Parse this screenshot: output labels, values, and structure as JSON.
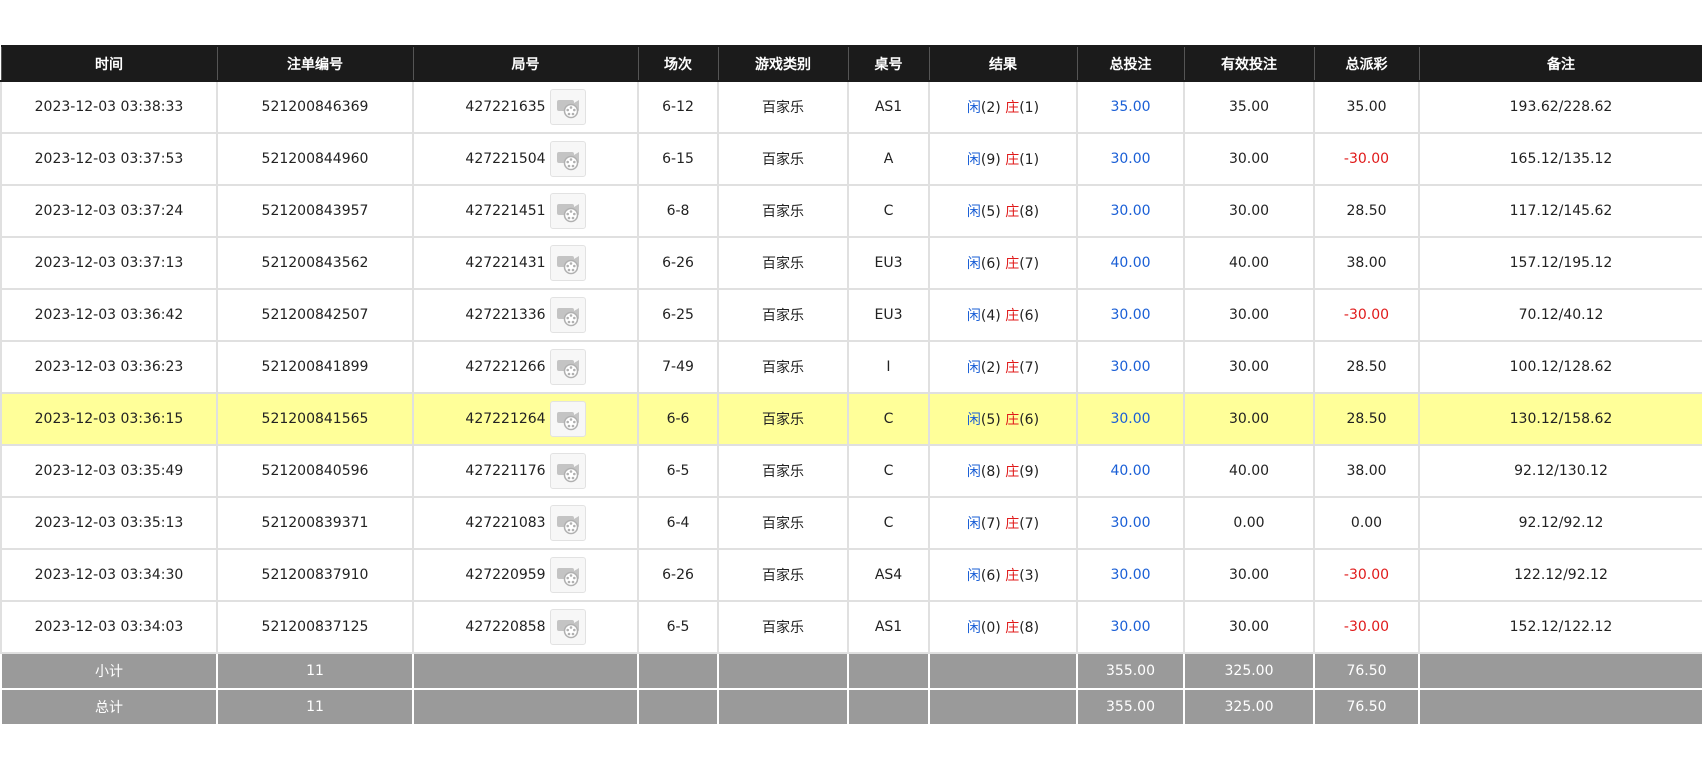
{
  "columns": [
    "时间",
    "注单编号",
    "局号",
    "场次",
    "游戏类别",
    "桌号",
    "结果",
    "总投注",
    "有效投注",
    "总派彩",
    "备注"
  ],
  "rows": [
    {
      "time": "2023-12-03 03:38:33",
      "bet_id": "521200846369",
      "round": "427221635",
      "session": "6-12",
      "game": "百家乐",
      "table": "AS1",
      "player_label": "闲",
      "player_score": "(2)",
      "banker_label": "庄",
      "banker_score": "(1)",
      "total_bet": "35.00",
      "valid_bet": "35.00",
      "payout": "35.00",
      "payout_negative": false,
      "remark": "193.62/228.62"
    },
    {
      "time": "2023-12-03 03:37:53",
      "bet_id": "521200844960",
      "round": "427221504",
      "session": "6-15",
      "game": "百家乐",
      "table": "A",
      "player_label": "闲",
      "player_score": "(9)",
      "banker_label": "庄",
      "banker_score": "(1)",
      "total_bet": "30.00",
      "valid_bet": "30.00",
      "payout": "-30.00",
      "payout_negative": true,
      "remark": "165.12/135.12"
    },
    {
      "time": "2023-12-03 03:37:24",
      "bet_id": "521200843957",
      "round": "427221451",
      "session": "6-8",
      "game": "百家乐",
      "table": "C",
      "player_label": "闲",
      "player_score": "(5)",
      "banker_label": "庄",
      "banker_score": "(8)",
      "total_bet": "30.00",
      "valid_bet": "30.00",
      "payout": "28.50",
      "payout_negative": false,
      "remark": "117.12/145.62"
    },
    {
      "time": "2023-12-03 03:37:13",
      "bet_id": "521200843562",
      "round": "427221431",
      "session": "6-26",
      "game": "百家乐",
      "table": "EU3",
      "player_label": "闲",
      "player_score": "(6)",
      "banker_label": "庄",
      "banker_score": "(7)",
      "total_bet": "40.00",
      "valid_bet": "40.00",
      "payout": "38.00",
      "payout_negative": false,
      "remark": "157.12/195.12"
    },
    {
      "time": "2023-12-03 03:36:42",
      "bet_id": "521200842507",
      "round": "427221336",
      "session": "6-25",
      "game": "百家乐",
      "table": "EU3",
      "player_label": "闲",
      "player_score": "(4)",
      "banker_label": "庄",
      "banker_score": "(6)",
      "total_bet": "30.00",
      "valid_bet": "30.00",
      "payout": "-30.00",
      "payout_negative": true,
      "remark": "70.12/40.12"
    },
    {
      "time": "2023-12-03 03:36:23",
      "bet_id": "521200841899",
      "round": "427221266",
      "session": "7-49",
      "game": "百家乐",
      "table": "I",
      "player_label": "闲",
      "player_score": "(2)",
      "banker_label": "庄",
      "banker_score": "(7)",
      "total_bet": "30.00",
      "valid_bet": "30.00",
      "payout": "28.50",
      "payout_negative": false,
      "remark": "100.12/128.62"
    },
    {
      "time": "2023-12-03 03:36:15",
      "bet_id": "521200841565",
      "round": "427221264",
      "session": "6-6",
      "game": "百家乐",
      "table": "C",
      "player_label": "闲",
      "player_score": "(5)",
      "banker_label": "庄",
      "banker_score": "(6)",
      "total_bet": "30.00",
      "valid_bet": "30.00",
      "payout": "28.50",
      "payout_negative": false,
      "remark": "130.12/158.62",
      "highlight": true
    },
    {
      "time": "2023-12-03 03:35:49",
      "bet_id": "521200840596",
      "round": "427221176",
      "session": "6-5",
      "game": "百家乐",
      "table": "C",
      "player_label": "闲",
      "player_score": "(8)",
      "banker_label": "庄",
      "banker_score": "(9)",
      "total_bet": "40.00",
      "valid_bet": "40.00",
      "payout": "38.00",
      "payout_negative": false,
      "remark": "92.12/130.12"
    },
    {
      "time": "2023-12-03 03:35:13",
      "bet_id": "521200839371",
      "round": "427221083",
      "session": "6-4",
      "game": "百家乐",
      "table": "C",
      "player_label": "闲",
      "player_score": "(7)",
      "banker_label": "庄",
      "banker_score": "(7)",
      "total_bet": "30.00",
      "valid_bet": "0.00",
      "payout": "0.00",
      "payout_negative": false,
      "remark": "92.12/92.12"
    },
    {
      "time": "2023-12-03 03:34:30",
      "bet_id": "521200837910",
      "round": "427220959",
      "session": "6-26",
      "game": "百家乐",
      "table": "AS4",
      "player_label": "闲",
      "player_score": "(6)",
      "banker_label": "庄",
      "banker_score": "(3)",
      "total_bet": "30.00",
      "valid_bet": "30.00",
      "payout": "-30.00",
      "payout_negative": true,
      "remark": "122.12/92.12"
    },
    {
      "time": "2023-12-03 03:34:03",
      "bet_id": "521200837125",
      "round": "427220858",
      "session": "6-5",
      "game": "百家乐",
      "table": "AS1",
      "player_label": "闲",
      "player_score": "(0)",
      "banker_label": "庄",
      "banker_score": "(8)",
      "total_bet": "30.00",
      "valid_bet": "30.00",
      "payout": "-30.00",
      "payout_negative": true,
      "remark": "152.12/122.12"
    }
  ],
  "subtotal": {
    "label": "小计",
    "count": "11",
    "total_bet": "355.00",
    "valid_bet": "325.00",
    "payout": "76.50"
  },
  "grandtotal": {
    "label": "总计",
    "count": "11",
    "total_bet": "355.00",
    "valid_bet": "325.00",
    "payout": "76.50"
  },
  "icons": {
    "replay": "video-replay-icon"
  },
  "colors": {
    "header_bg": "#1b1b1b",
    "footer_bg": "#9a9a9a",
    "highlight_bg": "#ffff99",
    "player_blue": "#1a5fd6",
    "banker_red": "#e01a1a"
  }
}
